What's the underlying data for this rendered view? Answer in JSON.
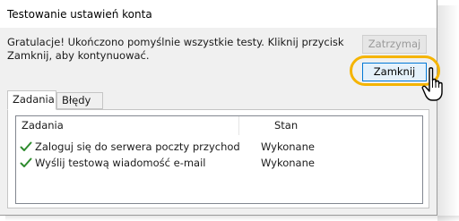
{
  "window": {
    "title": "Testowanie ustawień konta"
  },
  "message": "Gratulacje! Ukończono pomyślnie wszystkie testy. Kliknij przycisk Zamknij, aby kontynuować.",
  "buttons": {
    "stop_label": "Zatrzymaj",
    "close_label": "Zamknij"
  },
  "tabs": [
    {
      "label": "Zadania",
      "active": true
    },
    {
      "label": "Błędy",
      "active": false
    }
  ],
  "table": {
    "columns": [
      "Zadania",
      "Stan"
    ],
    "rows": [
      {
        "task": "Zaloguj się do serwera poczty przychodzą...",
        "status": "Wykonane",
        "icon": "check-icon"
      },
      {
        "task": "Wyślij testową wiadomość e-mail",
        "status": "Wykonane",
        "icon": "check-icon"
      }
    ]
  },
  "colors": {
    "highlight": "#f5b400",
    "check": "#2e8b2e",
    "focus_border": "#0078d7"
  }
}
